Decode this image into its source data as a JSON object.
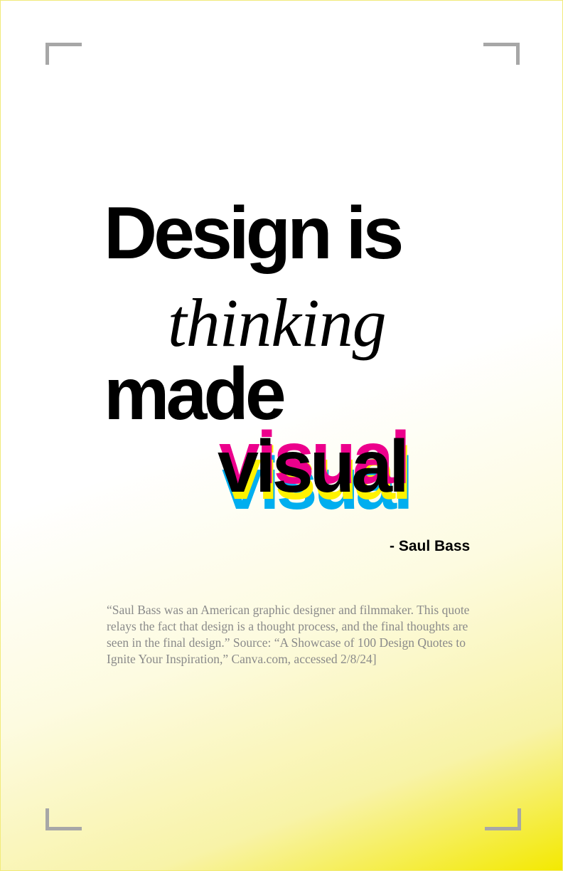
{
  "poster": {
    "headline_line1": "Design is",
    "headline_line2": "thinking",
    "headline_line3": "made",
    "headline_line4": "visual",
    "attribution": "- Saul Bass",
    "description": "“Saul Bass was an American graphic designer and filmmaker. This quote relays the fact that design is a thought process, and the final thoughts are seen in the final design.” Source: “A Showcase of 100 Design Quotes to Ignite Your Inspiration,” Canva.com, accessed 2/8/24]"
  },
  "colors": {
    "text": "#000000",
    "description_text": "#8a8a8a",
    "corner_marks": "#a7a7a7",
    "offset_cyan": "#00aeef",
    "offset_yellow": "#fff200",
    "offset_magenta": "#ec008c",
    "gradient_end": "#f3e900"
  }
}
